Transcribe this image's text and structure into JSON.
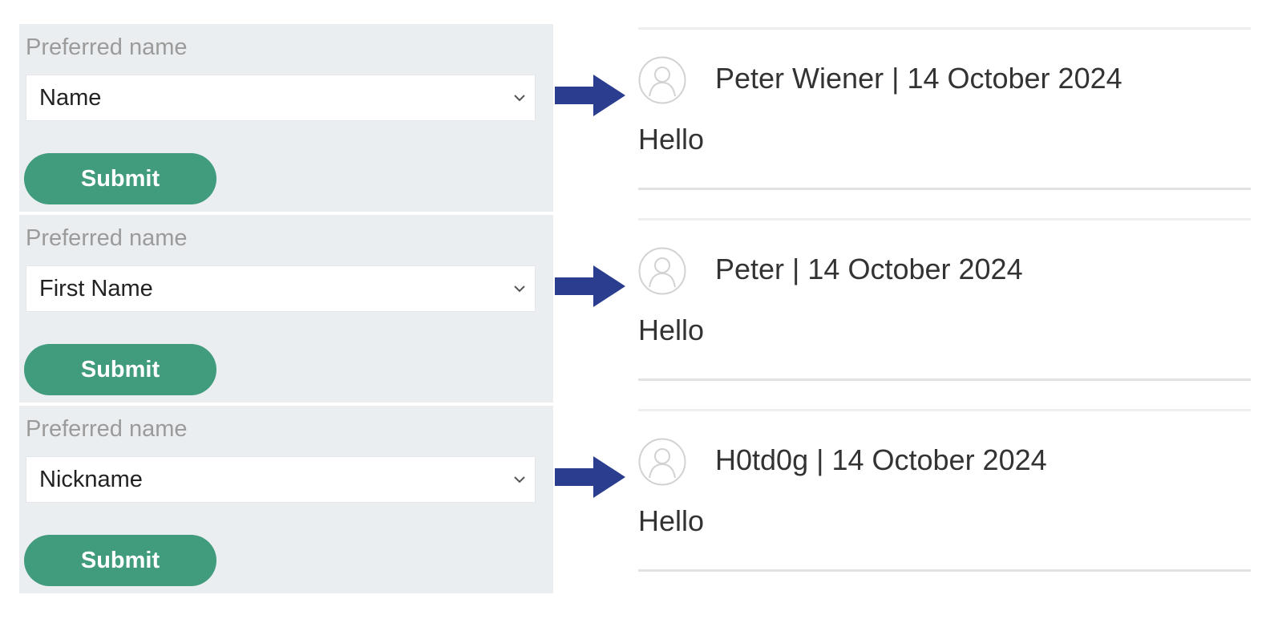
{
  "examples": [
    {
      "form": {
        "label": "Preferred name",
        "selected": "Name",
        "submit_label": "Submit"
      },
      "comment": {
        "author": "Peter Wiener",
        "separator": " | ",
        "date": "14 October 2024",
        "body": "Hello"
      }
    },
    {
      "form": {
        "label": "Preferred name",
        "selected": "First Name",
        "submit_label": "Submit"
      },
      "comment": {
        "author": "Peter",
        "separator": " | ",
        "date": "14 October 2024",
        "body": "Hello"
      }
    },
    {
      "form": {
        "label": "Preferred name",
        "selected": "Nickname",
        "submit_label": "Submit"
      },
      "comment": {
        "author": "H0td0g",
        "separator": " | ",
        "date": "14 October 2024",
        "body": "Hello"
      }
    }
  ],
  "colors": {
    "panel_bg": "#ebeef1",
    "submit_bg": "#419b7d",
    "arrow": "#2b3d8f",
    "label_gray": "#9b9b9b"
  },
  "icons": {
    "chevron": "chevron-down-icon",
    "arrow": "arrow-right-icon",
    "avatar": "user-avatar-icon"
  }
}
